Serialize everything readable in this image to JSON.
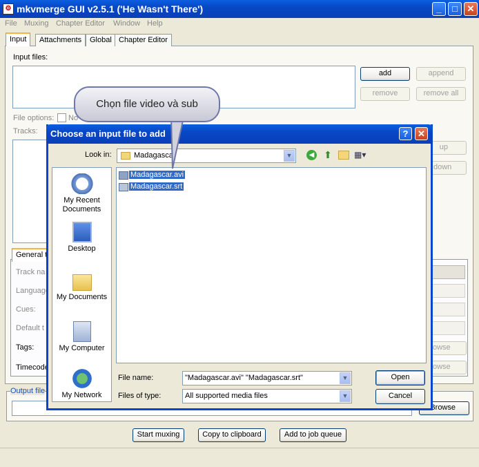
{
  "window": {
    "title": "mkvmerge GUI v2.5.1 ('He Wasn't There')"
  },
  "menu": [
    "File",
    "Muxing",
    "Chapter Editor",
    "Window",
    "Help"
  ],
  "tabs": [
    "Input",
    "Attachments",
    "Global",
    "Chapter Editor"
  ],
  "input": {
    "files_label": "Input files:",
    "add": "add",
    "append": "append",
    "remove": "remove",
    "remove_all": "remove all",
    "file_options": "File options:",
    "no_chapters": "No",
    "tracks": "Tracks:",
    "up": "up",
    "down": "down"
  },
  "track_tabs": {
    "general": "General t"
  },
  "track_fields": [
    "Track na",
    "Language",
    "Cues:",
    "Default t",
    "Tags:",
    "Timecode"
  ],
  "browse": [
    "owse",
    "owse"
  ],
  "output": {
    "label": "Output file",
    "browse": "Browse"
  },
  "bottom_buttons": [
    "Start muxing",
    "Copy to clipboard",
    "Add to job queue"
  ],
  "callout": "Chọn file video và sub",
  "dialog": {
    "title": "Choose an input file to add",
    "look_in_label": "Look in:",
    "look_in_value": "Madagascar",
    "places": [
      "My Recent Documents",
      "Desktop",
      "My Documents",
      "My Computer",
      "My Network"
    ],
    "files": [
      "Madagascar.avi",
      "Madagascar.srt"
    ],
    "filename_label": "File name:",
    "filename_value": "\"Madagascar.avi\" \"Madagascar.srt\"",
    "filetype_label": "Files of type:",
    "filetype_value": "All supported media files",
    "open": "Open",
    "cancel": "Cancel"
  },
  "colors": {
    "titlebar": "#0A47C8",
    "selection": "#316AC5",
    "face": "#ECE9D8"
  }
}
